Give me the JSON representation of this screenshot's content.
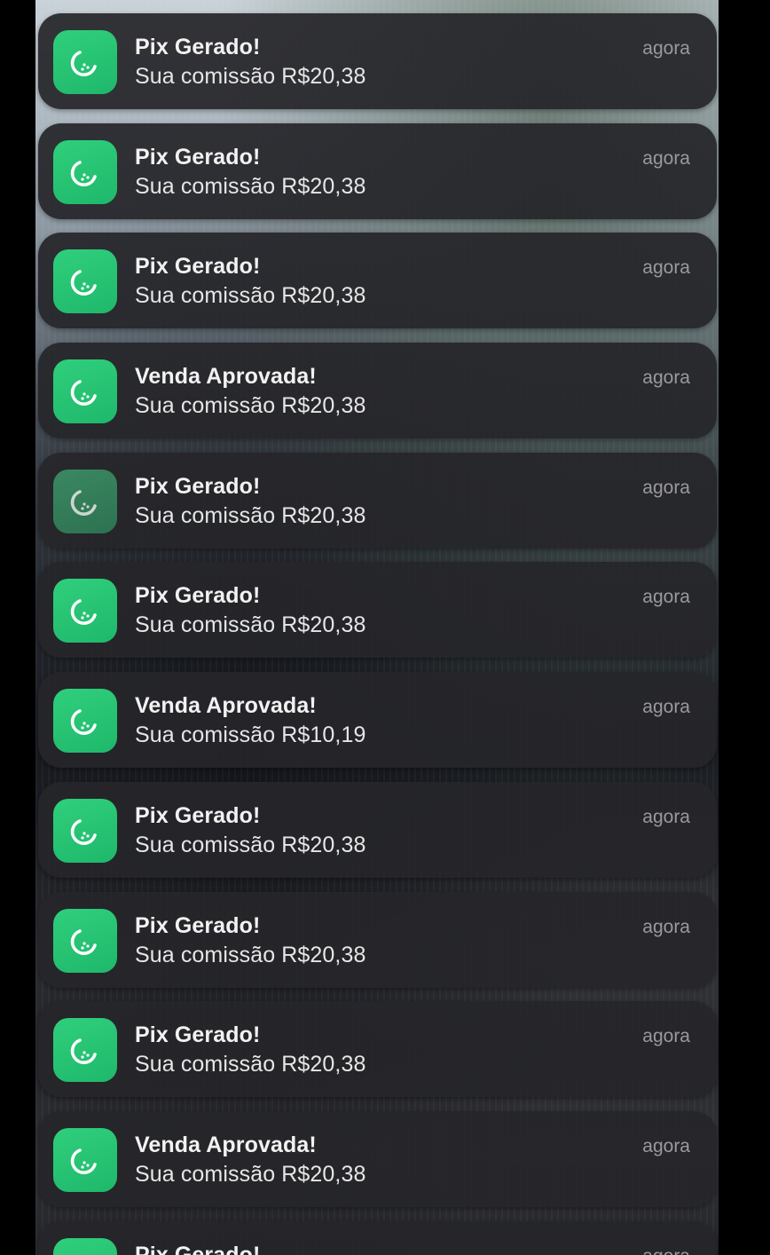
{
  "notifications": [
    {
      "title": "Pix Gerado!",
      "body": "Sua comissão R$20,38",
      "time": "agora",
      "icon": "melon-app-icon"
    },
    {
      "title": "Pix Gerado!",
      "body": "Sua comissão R$20,38",
      "time": "agora",
      "icon": "melon-app-icon"
    },
    {
      "title": "Pix Gerado!",
      "body": "Sua comissão R$20,38",
      "time": "agora",
      "icon": "melon-app-icon"
    },
    {
      "title": "Venda Aprovada!",
      "body": "Sua comissão R$20,38",
      "time": "agora",
      "icon": "melon-app-icon"
    },
    {
      "title": "Pix Gerado!",
      "body": "Sua comissão R$20,38",
      "time": "agora",
      "icon": "melon-app-icon"
    },
    {
      "title": "Pix Gerado!",
      "body": "Sua comissão R$20,38",
      "time": "agora",
      "icon": "melon-app-icon"
    },
    {
      "title": "Venda Aprovada!",
      "body": "Sua comissão R$10,19",
      "time": "agora",
      "icon": "melon-app-icon"
    },
    {
      "title": "Pix Gerado!",
      "body": "Sua comissão R$20,38",
      "time": "agora",
      "icon": "melon-app-icon"
    },
    {
      "title": "Pix Gerado!",
      "body": "Sua comissão R$20,38",
      "time": "agora",
      "icon": "melon-app-icon"
    },
    {
      "title": "Pix Gerado!",
      "body": "Sua comissão R$20,38",
      "time": "agora",
      "icon": "melon-app-icon"
    },
    {
      "title": "Venda Aprovada!",
      "body": "Sua comissão R$20,38",
      "time": "agora",
      "icon": "melon-app-icon"
    },
    {
      "title": "Pix Gerado!",
      "time": "agora",
      "icon": "melon-app-icon"
    }
  ],
  "colors": {
    "icon_green": "#22c06f",
    "card_bg": "#26262a",
    "time_text": "#9a9a9e"
  }
}
